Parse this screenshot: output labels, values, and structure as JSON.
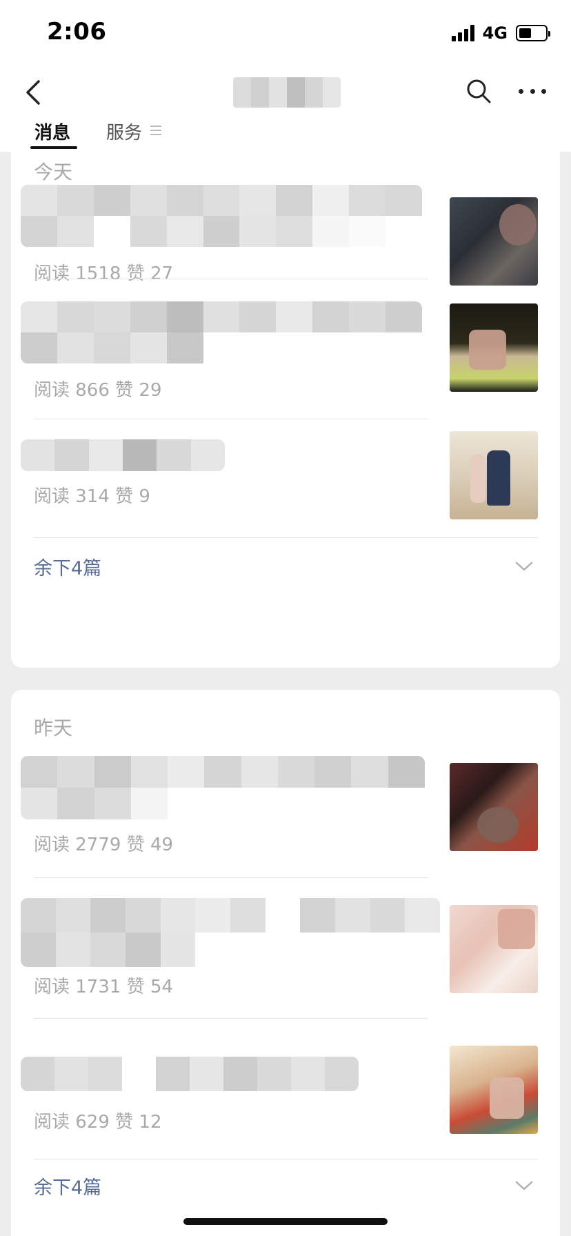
{
  "status_bar": {
    "time": "2:06",
    "network": "4G",
    "battery_level": 0.4
  },
  "nav": {
    "back_icon": "chevron-left-icon",
    "search_icon": "search-icon",
    "more_icon": "more-icon"
  },
  "tabs": [
    {
      "label": "消息",
      "active": true
    },
    {
      "label": "服务",
      "active": false
    }
  ],
  "sections": [
    {
      "label": "今天",
      "articles": [
        {
          "stats": "阅读 1518   赞 27"
        },
        {
          "stats": "阅读 866   赞 29"
        },
        {
          "stats": "阅读 314   赞 9"
        }
      ],
      "more_label": "余下4篇"
    },
    {
      "label": "昨天",
      "articles": [
        {
          "stats": "阅读 2779   赞 49"
        },
        {
          "stats": "阅读 1731   赞 54"
        },
        {
          "stats": "阅读 629   赞 12"
        }
      ],
      "more_label": "余下4篇"
    }
  ],
  "colors": {
    "background": "#ededed",
    "card": "#ffffff",
    "link": "#576b95",
    "muted_text": "#a9a9a9"
  }
}
